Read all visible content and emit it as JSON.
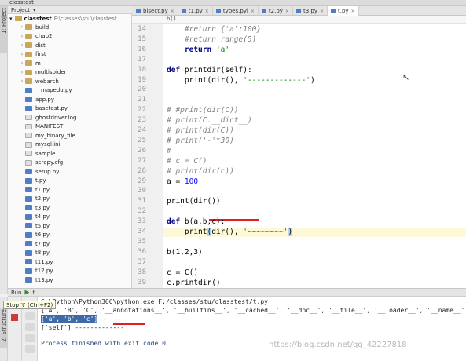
{
  "window": {
    "title": "classtest"
  },
  "left_tabs": {
    "project": "1: Project",
    "structure": "2: Structure"
  },
  "project_panel": {
    "header": "Project",
    "root_name": "classtest",
    "root_path": "F:\\classes\\stu\\classtest",
    "items": [
      {
        "label": "build",
        "kind": "folder",
        "expandable": true
      },
      {
        "label": "chap2",
        "kind": "folder",
        "expandable": true
      },
      {
        "label": "dist",
        "kind": "folder",
        "expandable": true
      },
      {
        "label": "first",
        "kind": "folder",
        "expandable": true
      },
      {
        "label": "m",
        "kind": "folder",
        "expandable": true
      },
      {
        "label": "multispider",
        "kind": "folder",
        "expandable": true
      },
      {
        "label": "webarch",
        "kind": "folder",
        "expandable": true
      },
      {
        "label": "__mapedu.py",
        "kind": "py",
        "expandable": false
      },
      {
        "label": "app.py",
        "kind": "py",
        "expandable": false
      },
      {
        "label": "basetest.py",
        "kind": "py",
        "expandable": false
      },
      {
        "label": "ghostdriver.log",
        "kind": "file",
        "expandable": false
      },
      {
        "label": "MANIFEST",
        "kind": "file",
        "expandable": false
      },
      {
        "label": "my_binary_file",
        "kind": "file",
        "expandable": false
      },
      {
        "label": "mysql.ini",
        "kind": "file",
        "expandable": false
      },
      {
        "label": "sample",
        "kind": "file",
        "expandable": false
      },
      {
        "label": "scrapy.cfg",
        "kind": "file",
        "expandable": false
      },
      {
        "label": "setup.py",
        "kind": "py",
        "expandable": false
      },
      {
        "label": "t.py",
        "kind": "py",
        "expandable": false
      },
      {
        "label": "t1.py",
        "kind": "py",
        "expandable": false
      },
      {
        "label": "t2.py",
        "kind": "py",
        "expandable": false
      },
      {
        "label": "t3.py",
        "kind": "py",
        "expandable": false
      },
      {
        "label": "t4.py",
        "kind": "py",
        "expandable": false
      },
      {
        "label": "t5.py",
        "kind": "py",
        "expandable": false
      },
      {
        "label": "t6.py",
        "kind": "py",
        "expandable": false
      },
      {
        "label": "t7.py",
        "kind": "py",
        "expandable": false
      },
      {
        "label": "t8.py",
        "kind": "py",
        "expandable": false
      },
      {
        "label": "t11.py",
        "kind": "py",
        "expandable": false
      },
      {
        "label": "t12.py",
        "kind": "py",
        "expandable": false
      },
      {
        "label": "t13.py",
        "kind": "py",
        "expandable": false
      }
    ]
  },
  "tabs": [
    {
      "label": "bisect.py",
      "active": false
    },
    {
      "label": "t1.py",
      "active": false
    },
    {
      "label": "types.pyi",
      "active": false
    },
    {
      "label": "t2.py",
      "active": false
    },
    {
      "label": "t3.py",
      "active": false
    },
    {
      "label": "t.py",
      "active": true
    }
  ],
  "breadcrumb": "b()",
  "editor_lines": [
    {
      "n": "14",
      "code": "    #return {'a':100}",
      "style": "cm"
    },
    {
      "n": "15",
      "code": "    #return range(5)",
      "style": "cm"
    },
    {
      "n": "16",
      "code": "    return 'a'",
      "style": "ret_a"
    },
    {
      "n": "17",
      "code": "",
      "style": "plain"
    },
    {
      "n": "18",
      "code": "def printdir(self):",
      "style": "def_printdir"
    },
    {
      "n": "19",
      "code": "    print(dir(), '-------------')",
      "style": "print_dash"
    },
    {
      "n": "20",
      "code": "",
      "style": "plain"
    },
    {
      "n": "21",
      "code": "",
      "style": "plain"
    },
    {
      "n": "22",
      "code": "# #print(dir(C))",
      "style": "cm"
    },
    {
      "n": "23",
      "code": "# print(C.__dict__)",
      "style": "cm"
    },
    {
      "n": "24",
      "code": "# print(dir(C))",
      "style": "cm"
    },
    {
      "n": "25",
      "code": "# print('-'*30)",
      "style": "cm"
    },
    {
      "n": "26",
      "code": "#",
      "style": "cm"
    },
    {
      "n": "27",
      "code": "# c = C()",
      "style": "cm"
    },
    {
      "n": "28",
      "code": "# print(dir(c))",
      "style": "cm"
    },
    {
      "n": "29",
      "code": "a = 100",
      "style": "a_eq"
    },
    {
      "n": "30",
      "code": "",
      "style": "plain"
    },
    {
      "n": "31",
      "code": "print(dir())",
      "style": "plain"
    },
    {
      "n": "32",
      "code": "",
      "style": "plain"
    },
    {
      "n": "33",
      "code": "def b(a,b,c):",
      "style": "def_b"
    },
    {
      "n": "34",
      "code": "    print(dir(), '~~~~~~~~')",
      "style": "print_tilde"
    },
    {
      "n": "35",
      "code": "",
      "style": "plain"
    },
    {
      "n": "36",
      "code": "b(1,2,3)",
      "style": "plain"
    },
    {
      "n": "37",
      "code": "",
      "style": "plain"
    },
    {
      "n": "38",
      "code": "c = C()",
      "style": "plain"
    },
    {
      "n": "39",
      "code": "c.printdir()",
      "style": "plain"
    }
  ],
  "run_panel": {
    "header": "Run",
    "config": "t",
    "tooltip": "Stop 't' (Ctrl+F2)",
    "console": {
      "command": "C:\\Python\\Python366\\python.exe F:/classes/stu/classtest/t.py",
      "line1": "['A', 'B', 'C', '__annotations__', '__builtins__', '__cached__', '__doc__', '__file__', '__loader__', '__name__'",
      "line2_selected": "['a', 'b', 'c']",
      "line2_rest": " ~~~~~~~~",
      "line3": "['self'] -------------",
      "finished": "Process finished with exit code 0"
    }
  },
  "watermark": "https://blog.csdn.net/qq_42227818",
  "colors": {
    "selection": "#3e6aa8",
    "current_line": "#fdf9d8",
    "annotation_red": "#e02020"
  }
}
